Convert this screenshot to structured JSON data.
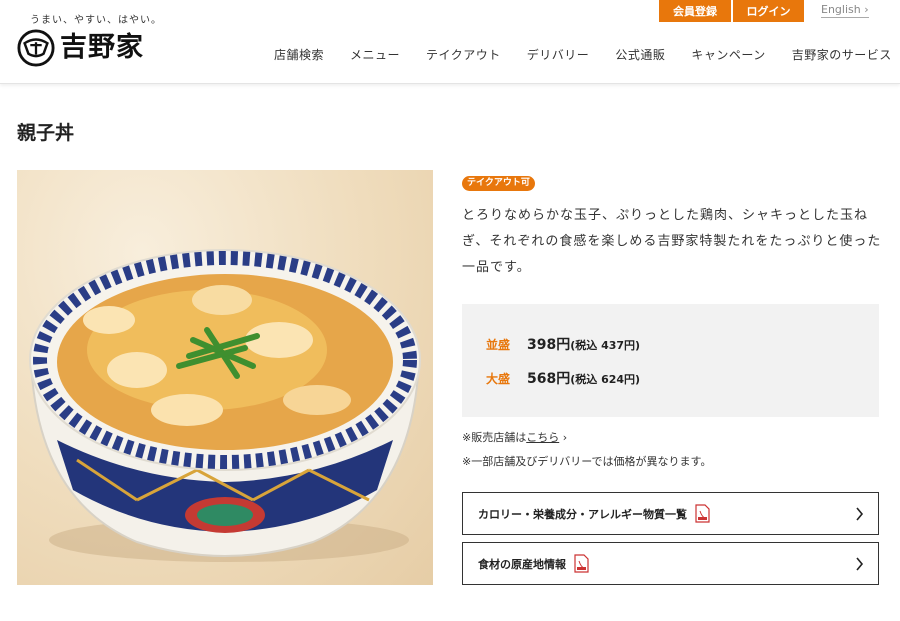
{
  "header": {
    "tagline": "うまい、やすい、はやい。",
    "logo_text": "吉野家",
    "register_label": "会員登録",
    "login_label": "ログイン",
    "english_label": "English",
    "nav": [
      "店舗検索",
      "メニュー",
      "テイクアウト",
      "デリバリー",
      "公式通販",
      "キャンペーン",
      "吉野家のサービス"
    ]
  },
  "product": {
    "title": "親子丼",
    "badge": "テイクアウト可",
    "description": "とろりなめらかな玉子、ぷりっとした鶏肉、シャキっとした玉ねぎ、それぞれの食感を楽しめる吉野家特製たれをたっぷりと使った一品です。",
    "prices": [
      {
        "label": "並盛",
        "price": "398円",
        "tax": "(税込 437円)"
      },
      {
        "label": "大盛",
        "price": "568円",
        "tax": "(税込 624円)"
      }
    ],
    "store_note_prefix": "※販売店舗は",
    "store_note_link": "こちら",
    "price_note": "※一部店舗及びデリバリーでは価格が異なります。",
    "links": [
      {
        "label": "カロリー・栄養成分・アレルギー物質一覧"
      },
      {
        "label": "食材の原産地情報"
      }
    ]
  },
  "colors": {
    "accent": "#e8770c",
    "price_box_bg": "#f2f2f2"
  },
  "icons": {
    "pdf": "pdf-file-icon",
    "chevron": "chevron-right-icon",
    "logo": "yoshinoya-logo-icon"
  }
}
